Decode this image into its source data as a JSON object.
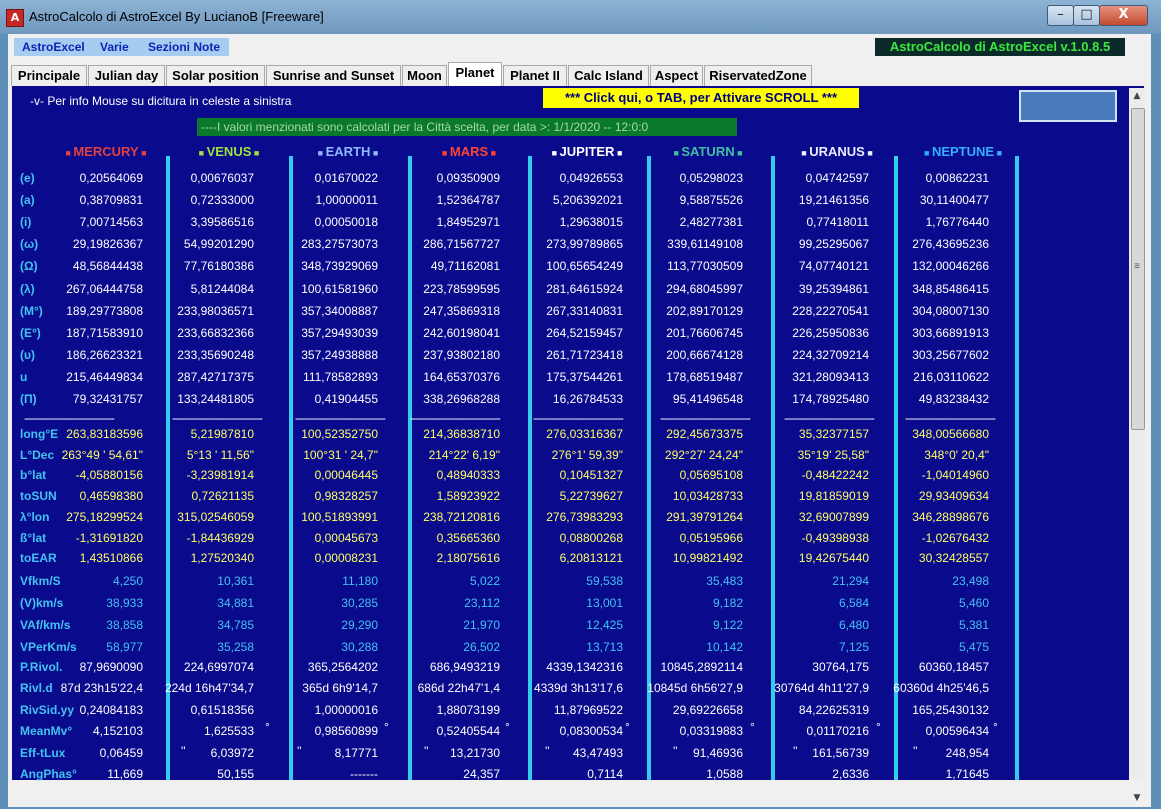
{
  "window": {
    "app_icon_letter": "A",
    "title": "AstroCalcolo di AstroExcel By LucianoB [Freeware]",
    "minimize": "–",
    "maximize": "□",
    "close": "X"
  },
  "menu": [
    "AstroExcel",
    "Varie",
    "Sezioni Note"
  ],
  "version": "AstroCalcolo di AstroExcel v.1.0.8.5",
  "tabs": [
    "Principale",
    "Julian day",
    "Solar position",
    "Sunrise and Sunset",
    "Moon",
    "Planet",
    "Planet II",
    "Calc Island",
    "Aspect",
    "RiservatedZone"
  ],
  "active_tab": "Planet",
  "info_text": "-v- Per info Mouse su dicitura in celeste a sinistra",
  "scroll_button": "*** Click qui, o TAB,  per Attivare SCROLL ***",
  "notice": "----I valori menzionati sono calcolati per la Città scelta, per data >: 1/1/2020 -- 12:0:0",
  "dash_separator": "------------------------------",
  "colors": {
    "content_bg": "#0a0a8c",
    "label_cyan": "#41c3f2",
    "yellow": "#ffff66",
    "white": "#ffffff",
    "vline": "#33ccee"
  },
  "planets": [
    {
      "name": "MERCURY",
      "color": "#e04040",
      "marker_color": "#e04040"
    },
    {
      "name": "VENUS",
      "color": "#a0e040",
      "marker_color": "#a0e040"
    },
    {
      "name": "EARTH",
      "color": "#8fb8ff",
      "marker_color": "#8fb8ff"
    },
    {
      "name": "MARS",
      "color": "#ff4433",
      "marker_color": "#ff4433"
    },
    {
      "name": "JUPITER",
      "color": "#ffffff",
      "marker_color": "#ffffff"
    },
    {
      "name": "SATURN",
      "color": "#40c0a0",
      "marker_color": "#40c0a0"
    },
    {
      "name": "URANUS",
      "color": "#e8f0ff",
      "marker_color": "#e8f0ff"
    },
    {
      "name": "NEPTUNE",
      "color": "#33b0ff",
      "marker_color": "#33b0ff"
    }
  ],
  "rows_top": [
    {
      "label": "(e)",
      "values": [
        "0,20564069",
        "0,00676037",
        "0,01670022",
        "0,09350909",
        "0,04926553",
        "0,05298023",
        "0,04742597",
        "0,00862231"
      ]
    },
    {
      "label": "(a)",
      "values": [
        "0,38709831",
        "0,72333000",
        "1,00000011",
        "1,52364787",
        "5,206392021",
        "9,58875526",
        "19,21461356",
        "30,11400477"
      ]
    },
    {
      "label": "(i)",
      "values": [
        "7,00714563",
        "3,39586516",
        "0,00050018",
        "1,84952971",
        "1,29638015",
        "2,48277381",
        "0,77418011",
        "1,76776440"
      ]
    },
    {
      "label": "(ω)",
      "values": [
        "29,19826367",
        "54,99201290",
        "283,27573073",
        "286,71567727",
        "273,99789865",
        "339,61149108",
        "99,25295067",
        "276,43695236"
      ]
    },
    {
      "label": "(Ω)",
      "values": [
        "48,56844438",
        "77,76180386",
        "348,73929069",
        "49,71162081",
        "100,65654249",
        "113,77030509",
        "74,07740121",
        "132,00046266"
      ]
    },
    {
      "label": "(λ)",
      "values": [
        "267,06444758",
        "5,81244084",
        "100,61581960",
        "223,78599595",
        "281,64615924",
        "294,68045997",
        "39,25394861",
        "348,85486415"
      ]
    },
    {
      "label": "(M°)",
      "values": [
        "189,29773808",
        "233,98036571",
        "357,34008887",
        "247,35869318",
        "267,33140831",
        "202,89170129",
        "228,22270541",
        "304,08007130"
      ]
    },
    {
      "label": "(E°)",
      "values": [
        "187,71583910",
        "233,66832366",
        "357,29493039",
        "242,60198041",
        "264,52159457",
        "201,76606745",
        "226,25950836",
        "303,66891913"
      ]
    },
    {
      "label": "(υ)",
      "values": [
        "186,26623321",
        "233,35690248",
        "357,24938888",
        "237,93802180",
        "261,71723418",
        "200,66674128",
        "224,32709214",
        "303,25677602"
      ]
    },
    {
      "label": "u",
      "values": [
        "215,46449834",
        "287,42717375",
        "111,78582893",
        "164,65370376",
        "175,37544261",
        "178,68519487",
        "321,28093413",
        "216,03110622"
      ]
    },
    {
      "label": "(Π)",
      "values": [
        "79,32431757",
        "133,24481805",
        "0,41904455",
        "338,26968288",
        "16,26784533",
        "95,41496548",
        "174,78925480",
        "49,83238432"
      ]
    }
  ],
  "rows_yellow": [
    {
      "label": "long°E",
      "values": [
        "263,83183596",
        "5,21987810",
        "100,52352750",
        "214,36838710",
        "276,03316367",
        "292,45673375",
        "35,32377157",
        "348,00566680"
      ]
    },
    {
      "label": "L°Dec",
      "values": [
        "263°49 ' 54,61\"",
        "5°13 ' 11,56\"",
        "100°31 ' 24,7\"",
        "214°22' 6,19\"",
        "276°1' 59,39\"",
        "292°27' 24,24\"",
        "35°19' 25,58\"",
        "348°0' 20,4\""
      ]
    },
    {
      "label": "b°lat",
      "values": [
        "-4,05880156",
        "-3,23981914",
        "0,00046445",
        "0,48940333",
        "0,10451327",
        "0,05695108",
        "-0,48422242",
        "-1,04014960"
      ]
    },
    {
      "label": "toSUN",
      "values": [
        "0,46598380",
        "0,72621135",
        "0,98328257",
        "1,58923922",
        "5,22739627",
        "10,03428733",
        "19,81859019",
        "29,93409634"
      ]
    },
    {
      "label": "λ°lon",
      "values": [
        "275,18299524",
        "315,02546059",
        "100,51893991",
        "238,72120816",
        "276,73983293",
        "291,39791264",
        "32,69007899",
        "346,28898676"
      ]
    },
    {
      "label": "ß°lat",
      "values": [
        "-1,31691820",
        "-1,84436929",
        "0,00045673",
        "0,35665360",
        "0,08800268",
        "0,05195966",
        "-0,49398938",
        "-1,02676432"
      ]
    },
    {
      "label": "toEAR",
      "values": [
        "1,43510866",
        "1,27520340",
        "0,00008231",
        "2,18075616",
        "6,20813121",
        "10,99821492",
        "19,42675440",
        "30,32428557"
      ]
    }
  ],
  "rows_cyan": [
    {
      "label": "Vfkm/S",
      "values": [
        "4,250",
        "10,361",
        "11,180",
        "5,022",
        "59,538",
        "35,483",
        "21,294",
        "23,498"
      ]
    },
    {
      "label": "(V)km/s",
      "values": [
        "38,933",
        "34,881",
        "30,285",
        "23,112",
        "13,001",
        "9,182",
        "6,584",
        "5,460"
      ]
    },
    {
      "label": "VAf/km/s",
      "values": [
        "38,858",
        "34,785",
        "29,290",
        "21,970",
        "12,425",
        "9,122",
        "6,480",
        "5,381"
      ]
    },
    {
      "label": "VPerKm/s",
      "values": [
        "58,977",
        "35,258",
        "30,288",
        "26,502",
        "13,713",
        "10,142",
        "7,125",
        "5,475"
      ]
    }
  ],
  "rows_bottom": [
    {
      "label": "P.Rivol.",
      "values": [
        "87,9690090",
        "224,6997074",
        "365,2564202",
        "686,9493219",
        "4339,1342316",
        "10845,2892114",
        "30764,175",
        "60360,18457"
      ]
    },
    {
      "label": "Rivl.d",
      "values": [
        "87d 23h15'22,4",
        "224d 16h47'34,7",
        "365d 6h9'14,7",
        "686d 22h47'1,4",
        "4339d 3h13'17,6",
        "10845d 6h56'27,9",
        "30764d 4h11'27,9",
        "60360d 4h25'46,5"
      ]
    },
    {
      "label": "RivSid.yy",
      "values": [
        "0,24084183",
        "0,61518356",
        "1,00000016",
        "1,88073199",
        "11,87969522",
        "29,69226658",
        "84,22625319",
        "165,25430132"
      ]
    },
    {
      "label": "MeanMv°",
      "values": [
        "4,152103",
        "1,625533",
        "0,98560899",
        "0,52405544",
        "0,08300534",
        "0,03319883",
        "0,01170216",
        "0,00596434"
      ]
    },
    {
      "label": "Eff-tLux",
      "values": [
        "0,06459",
        "6,03972",
        "8,17771",
        "13,21730",
        "43,47493",
        "91,46936",
        "161,56739",
        "248,954"
      ]
    },
    {
      "label": "AngPhas°",
      "values": [
        "11,669",
        "50,155",
        "-------",
        "24,357",
        "0,7114",
        "1,0588",
        "2,6336",
        "1,71645"
      ]
    }
  ],
  "meanmv_suffix": "°",
  "eff_prefix": "''"
}
